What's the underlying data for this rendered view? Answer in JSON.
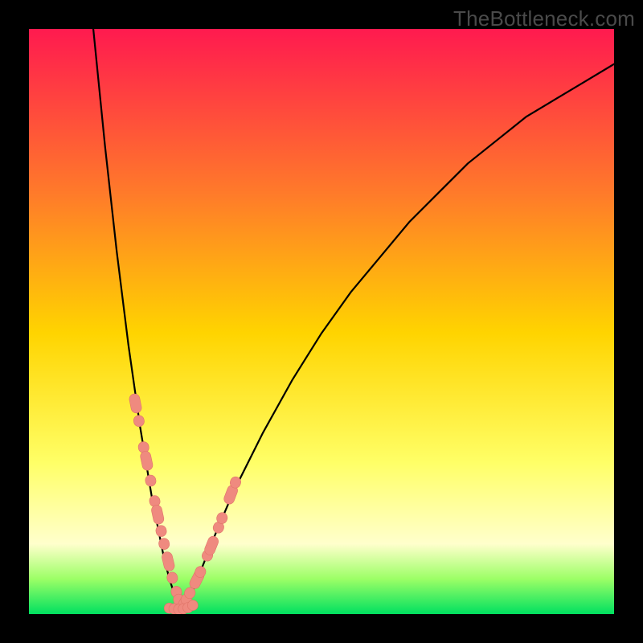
{
  "watermark": "TheBottleneck.com",
  "colors": {
    "frame": "#000000",
    "gradient_top": "#ff1a4f",
    "gradient_mid_upper": "#ff7a2a",
    "gradient_mid": "#ffd400",
    "gradient_lower": "#ffff66",
    "gradient_pale": "#ffffcc",
    "gradient_green_light": "#9cff66",
    "gradient_green": "#00e060",
    "curve": "#000000",
    "marker_fill": "#ef8a7f",
    "marker_stroke": "#e07468"
  },
  "chart_data": {
    "type": "line",
    "title": "",
    "xlabel": "",
    "ylabel": "",
    "xlim": [
      0,
      100
    ],
    "ylim": [
      0,
      100
    ],
    "curve_left": {
      "x": [
        11,
        12,
        13,
        14,
        15,
        16,
        17,
        18,
        19,
        20,
        21,
        22,
        23,
        24,
        25,
        26
      ],
      "y": [
        100,
        90,
        80,
        71,
        62,
        54,
        46,
        39,
        32,
        26,
        20,
        15,
        10,
        6,
        3,
        1
      ]
    },
    "curve_right": {
      "x": [
        26,
        28,
        30,
        32,
        35,
        40,
        45,
        50,
        55,
        60,
        65,
        70,
        75,
        80,
        85,
        90,
        95,
        100
      ],
      "y": [
        1,
        4,
        9,
        14,
        21,
        31,
        40,
        48,
        55,
        61,
        67,
        72,
        77,
        81,
        85,
        88,
        91,
        94
      ]
    },
    "markers_left": {
      "x": [
        18.2,
        18.8,
        19.6,
        20.1,
        20.8,
        21.5,
        22.0,
        22.6,
        23.1,
        23.8,
        24.5,
        25.2,
        25.8
      ],
      "y": [
        36.0,
        33.0,
        28.5,
        26.2,
        22.8,
        19.3,
        17.0,
        14.2,
        12.0,
        9.0,
        6.2,
        3.8,
        1.8
      ]
    },
    "markers_right": {
      "x": [
        26.4,
        26.9,
        27.5,
        28.7,
        29.3,
        30.5,
        31.2,
        32.4,
        33.0,
        34.5,
        35.3
      ],
      "y": [
        1.6,
        2.5,
        3.6,
        5.9,
        7.2,
        10.0,
        11.7,
        14.8,
        16.4,
        20.4,
        22.5
      ]
    },
    "markers_bottom": {
      "x": [
        24.0,
        24.8,
        25.6,
        26.4,
        27.2,
        28.0
      ],
      "y": [
        1.0,
        0.9,
        0.8,
        0.9,
        1.1,
        1.5
      ]
    }
  }
}
